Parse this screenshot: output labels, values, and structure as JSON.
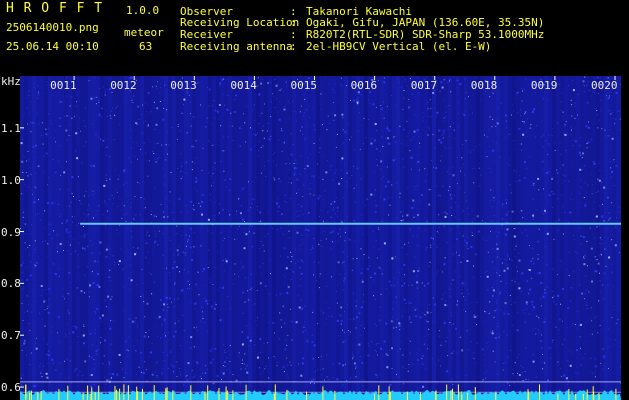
{
  "header": {
    "app_name": "H R O F F T",
    "version": "1.0.0",
    "filename": "2506140010.png",
    "category": "meteor",
    "datetime": "25.06.14 00:10",
    "count": "63"
  },
  "info": {
    "rows": [
      {
        "key": "Observer",
        "sep": ":",
        "value": "Takanori Kawachi"
      },
      {
        "key": "Receiving Location",
        "sep": ":",
        "value": "Ogaki, Gifu, JAPAN (136.60E, 35.35N)"
      },
      {
        "key": "Receiver",
        "sep": ":",
        "value": "R820T2(RTL-SDR) SDR-Sharp 53.1000MHz"
      },
      {
        "key": "Receiving antenna",
        "sep": ":",
        "value": "2el-HB9CV Vertical (el. E-W)"
      }
    ]
  },
  "spectrogram": {
    "y_unit": "kHz",
    "y_ticks": [
      "1.1",
      "1.0",
      "0.9",
      "0.8",
      "0.7",
      "0.6"
    ],
    "y_tick_values": [
      1.1,
      1.0,
      0.9,
      0.8,
      0.7,
      0.6
    ],
    "y_range": [
      0.575,
      1.2
    ],
    "time_labels": [
      "0011",
      "0012",
      "0013",
      "0014",
      "0015",
      "0016",
      "0017",
      "0018",
      "0019",
      "0020"
    ],
    "carrier_freq_khz": 0.915,
    "carrier_start_fraction": 0.1,
    "colors": {
      "background": "#0a0a6e",
      "noise_blue": "#2a3cff",
      "noise_light": "#9fb4ff",
      "carrier": "#6fd9ff",
      "bottom_trace": "#22ccff",
      "trace_spikes": "#ffff33",
      "ref_line": "#c8c8ff"
    }
  }
}
